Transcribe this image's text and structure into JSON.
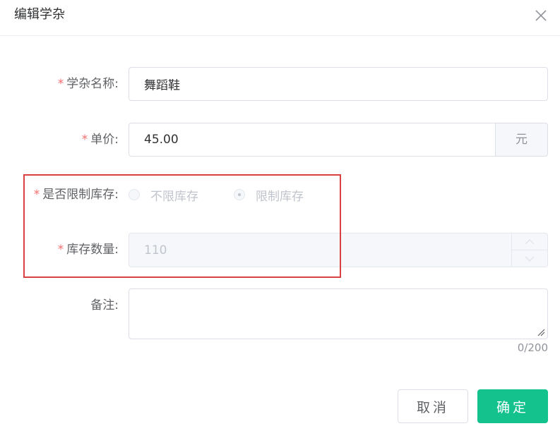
{
  "dialog": {
    "title": "编辑学杂",
    "close_icon": "close-icon"
  },
  "form": {
    "required_mark": "*",
    "name": {
      "label": "学杂名称:",
      "value": "舞蹈鞋"
    },
    "price": {
      "label": "单价:",
      "value": "45.00",
      "unit": "元"
    },
    "limit_stock": {
      "label": "是否限制库存:",
      "options": [
        "不限库存",
        "限制库存"
      ],
      "selected": "限制库存",
      "disabled": true
    },
    "stock_qty": {
      "label": "库存数量:",
      "value": "110",
      "disabled": true
    },
    "remark": {
      "label": "备注:",
      "value": "",
      "counter": "0/200"
    }
  },
  "footer": {
    "cancel_label": "取消",
    "confirm_label": "确定"
  },
  "colors": {
    "primary": "#13c28d",
    "required": "#f56c6c",
    "highlight": "#d94141"
  }
}
